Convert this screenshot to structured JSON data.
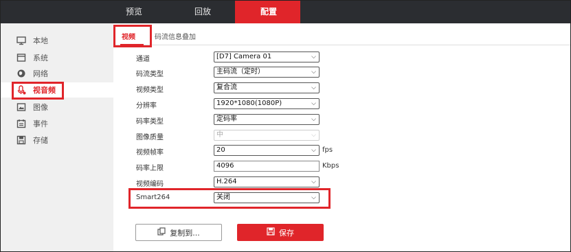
{
  "topnav": {
    "preview": "预览",
    "playback": "回放",
    "config": "配置"
  },
  "sidebar": {
    "items": [
      {
        "label": "本地",
        "icon": "monitor-icon"
      },
      {
        "label": "系统",
        "icon": "system-window-icon"
      },
      {
        "label": "网络",
        "icon": "globe-icon"
      },
      {
        "label": "视音频",
        "icon": "microphone-icon"
      },
      {
        "label": "图像",
        "icon": "image-icon"
      },
      {
        "label": "事件",
        "icon": "calendar-icon"
      },
      {
        "label": "存储",
        "icon": "floppy-disk-icon"
      }
    ]
  },
  "tabs": {
    "video": "视频",
    "overlay": "码流信息叠加"
  },
  "form": {
    "channel": {
      "label": "通道",
      "value": "[D7] Camera 01"
    },
    "stream_type": {
      "label": "码流类型",
      "value": "主码流（定时）"
    },
    "video_type": {
      "label": "视频类型",
      "value": "复合流"
    },
    "resolution": {
      "label": "分辨率",
      "value": "1920*1080(1080P)"
    },
    "bitrate_type": {
      "label": "码率类型",
      "value": "定码率"
    },
    "quality": {
      "label": "图像质量",
      "value": "中"
    },
    "framerate": {
      "label": "视频帧率",
      "value": "20",
      "unit": "fps"
    },
    "bitrate_max": {
      "label": "码率上限",
      "value": "4096",
      "unit": "Kbps"
    },
    "encoding": {
      "label": "视频编码",
      "value": "H.264"
    },
    "smart264": {
      "label": "Smart264",
      "value": "关闭"
    }
  },
  "buttons": {
    "copy": "复制到...",
    "save": "保存"
  },
  "colors": {
    "accent": "#e0252a",
    "topbar": "#2b2d31",
    "sidebar": "#f0f0f0"
  }
}
